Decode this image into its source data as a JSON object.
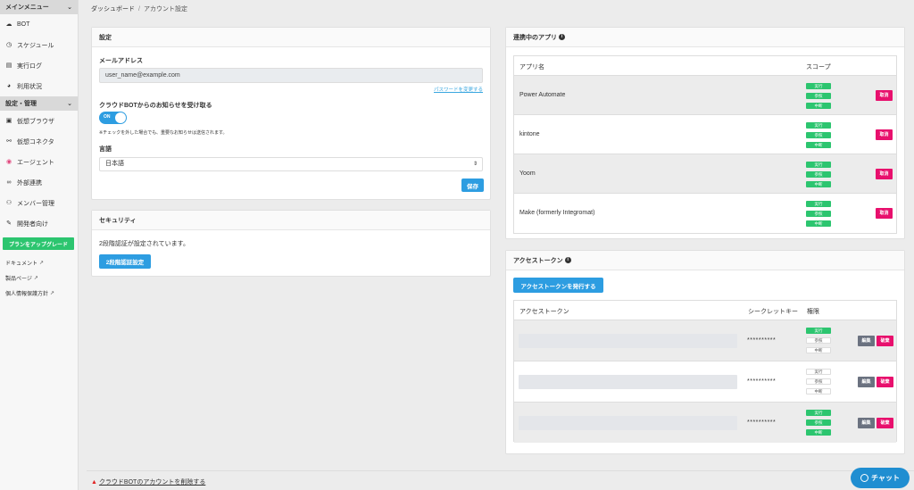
{
  "sidebar": {
    "main_menu_label": "メインメニュー",
    "main_items": [
      {
        "label": "BOT",
        "icon": "bot-icon"
      },
      {
        "label": "スケジュール",
        "icon": "clock-icon"
      },
      {
        "label": "実行ログ",
        "icon": "file-icon"
      },
      {
        "label": "利用状況",
        "icon": "chart-icon"
      }
    ],
    "settings_menu_label": "設定・管理",
    "settings_items": [
      {
        "label": "仮想ブラウザ",
        "icon": "browser-icon"
      },
      {
        "label": "仮想コネクタ",
        "icon": "connector-icon"
      },
      {
        "label": "エージェント",
        "icon": "agent-icon"
      },
      {
        "label": "外部連携",
        "icon": "link-icon"
      },
      {
        "label": "メンバー管理",
        "icon": "users-icon"
      },
      {
        "label": "開発者向け",
        "icon": "wrench-icon"
      }
    ],
    "upgrade_label": "プランをアップグレード",
    "links": [
      {
        "label": "ドキュメント"
      },
      {
        "label": "製品ページ"
      },
      {
        "label": "個人情報保護方針"
      }
    ]
  },
  "breadcrumb": {
    "home": "ダッシュボード",
    "sep": "/",
    "current": "アカウント設定"
  },
  "settings": {
    "title": "設定",
    "email_label": "メールアドレス",
    "email_value": "user_name@example.com",
    "password_link": "パスワードを変更する",
    "notify_label": "クラウドBOTからのお知らせを受け取る",
    "toggle_label": "ON",
    "note": "※チェックを外した場合でも、重要なお知らせは送信されます。",
    "language_label": "言語",
    "language_value": "日本語",
    "save_label": "保存"
  },
  "security": {
    "title": "セキュリティ",
    "message": "2段階認証が設定されています。",
    "button_label": "2段階認証設定"
  },
  "apps": {
    "title": "連携中のアプリ",
    "col_name": "アプリ名",
    "col_scope": "スコープ",
    "scope_labels": [
      "実行",
      "参照",
      "中断"
    ],
    "cancel_label": "取消",
    "rows": [
      {
        "name": "Power Automate"
      },
      {
        "name": "kintone"
      },
      {
        "name": "Yoom"
      },
      {
        "name": "Make (formerly Integromat)"
      }
    ]
  },
  "tokens": {
    "title": "アクセストークン",
    "issue_label": "アクセストークンを発行する",
    "col_token": "アクセストークン",
    "col_secret": "シークレットキー",
    "col_perm": "権限",
    "edit_label": "編集",
    "delete_label": "破棄",
    "rows": [
      {
        "secret": "**********",
        "perms": [
          "実行",
          "参照",
          "中断"
        ],
        "active": [
          true,
          false,
          false
        ]
      },
      {
        "secret": "**********",
        "perms": [
          "実行",
          "参照",
          "中断"
        ],
        "active": [
          false,
          false,
          false
        ]
      },
      {
        "secret": "**********",
        "perms": [
          "実行",
          "参照",
          "中断"
        ],
        "active": [
          true,
          true,
          true
        ]
      }
    ]
  },
  "footer": {
    "delete_account": "クラウドBOTのアカウントを削除する"
  },
  "chat": {
    "label": "チャット"
  },
  "colors": {
    "accent": "#2d9de1",
    "green": "#2cc56f",
    "pink": "#e8106d"
  }
}
